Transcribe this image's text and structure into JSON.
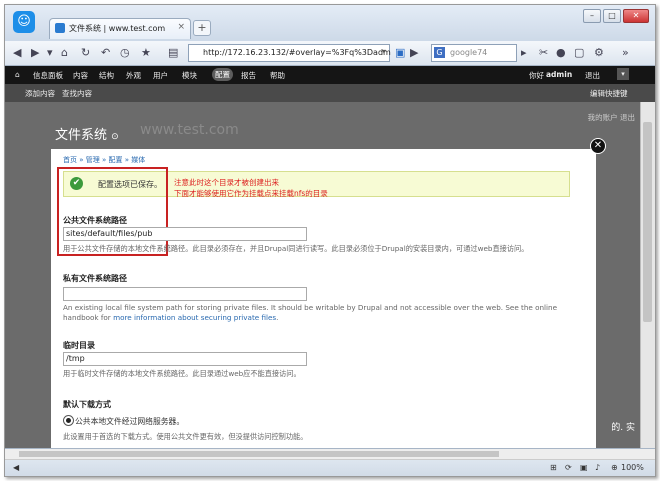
{
  "browser": {
    "tab_title": "文件系统 | www.test.com",
    "url": "http://172.16.23.132/#overlay=%3Fq%3Dadm",
    "search_placeholder": "google74",
    "new_tab": "+",
    "zoom": "100%"
  },
  "toolbar": {
    "home": "⌂",
    "items": [
      "信息面板",
      "内容",
      "结构",
      "外观",
      "用户",
      "模块",
      "配置",
      "报告",
      "帮助"
    ],
    "greeting": "你好",
    "user": "admin",
    "logout": "退出",
    "shortcuts": [
      "添加内容",
      "查找内容"
    ],
    "edit_shortcuts": "编辑快捷键"
  },
  "page": {
    "title": "文件系统",
    "watermark": "www.test.com",
    "top_links": "我的账户   退出",
    "side_text": "的. 实"
  },
  "overlay": {
    "breadcrumb": "首页 » 管理 » 配置 » 媒体",
    "status_message": "配置选项已保存。",
    "annotation_line1": "注意此时这个目录才被创建出来",
    "annotation_line2": "下面才能够使用它作为挂载点来挂载nfs的目录",
    "public_label": "公共文件系统路径",
    "public_value": "sites/default/files/pub",
    "public_desc": "用于公共文件存储的本地文件系统路径。此目录必须存在，并且Drupal同进行读写。此目录必须位于Drupal的安装目录内，可通过web直接访问。",
    "private_label": "私有文件系统路径",
    "private_value": "",
    "private_desc_1": "An existing local file system path for storing private files. It should be writable by Drupal and not accessible over the web. See the online",
    "private_desc_2a": "handbook for",
    "private_desc_link": "more information about securing private files",
    "private_desc_2b": ".",
    "temp_label": "临时目录",
    "temp_value": "/tmp",
    "temp_desc": "用于临时文件存储的本地文件系统路径。此目录通过web应不能直接访问。",
    "download_label": "默认下载方式",
    "download_option": "公共本地文件经过网络服务器。",
    "download_desc": "此设置用于首选的下载方式。使用公共文件更有效，但没提供访问控制功能。"
  }
}
